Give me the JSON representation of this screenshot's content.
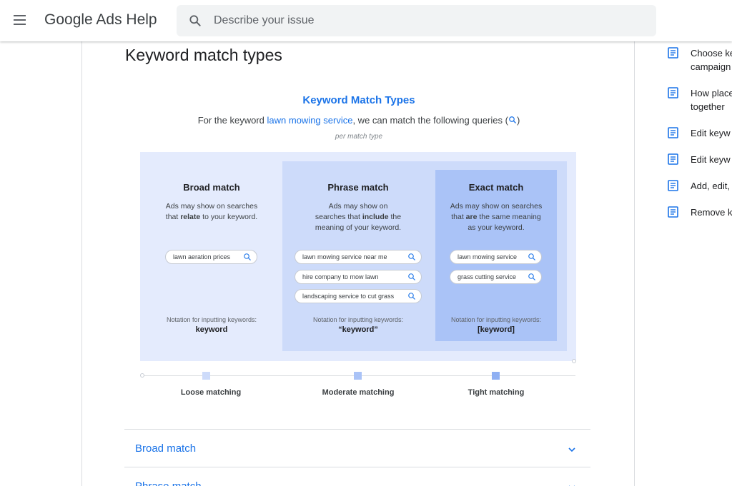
{
  "header": {
    "app_title": "Google Ads Help",
    "search_placeholder": "Describe your issue"
  },
  "article": {
    "title": "Keyword match types"
  },
  "figure": {
    "title": "Keyword Match Types",
    "subtitle_prefix": "For the keyword ",
    "subtitle_keyword": "lawn mowing service",
    "subtitle_suffix": ", we can match the following queries (",
    "subtitle_close": ")",
    "per_match_type": "per match type",
    "columns": [
      {
        "heading": "Broad match",
        "desc_l1": "Ads may show on searches",
        "desc_l2_a": "that ",
        "desc_l2_b": "relate",
        "desc_l2_c": " to your keyword.",
        "queries": [
          "lawn aeration prices"
        ],
        "notation_label": "Notation for inputting keywords:",
        "notation_value": "keyword"
      },
      {
        "heading": "Phrase match",
        "desc_l1": "Ads may show on",
        "desc_l2_a": "searches that ",
        "desc_l2_b": "include",
        "desc_l2_c": " the",
        "desc_l3": "meaning of your keyword.",
        "queries": [
          "lawn mowing service near me",
          "hire company to mow lawn",
          "landscaping service to cut grass"
        ],
        "notation_label": "Notation for inputting keywords:",
        "notation_value": "“keyword”"
      },
      {
        "heading": "Exact match",
        "desc_l1": "Ads may show on searches",
        "desc_l2_a": "that ",
        "desc_l2_b": "are",
        "desc_l2_c": " the same meaning",
        "desc_l3": "as your keyword.",
        "queries": [
          "lawn mowing service",
          "grass cutting service"
        ],
        "notation_label": "Notation for inputting keywords:",
        "notation_value": "[keyword]"
      }
    ],
    "scale": [
      "Loose matching",
      "Moderate matching",
      "Tight matching"
    ]
  },
  "accordion": [
    {
      "label": "Broad match"
    },
    {
      "label": "Phrase match"
    }
  ],
  "sidebar": {
    "items": [
      {
        "l1": "Choose ke",
        "l2": "campaign"
      },
      {
        "l1": "How place",
        "l2": "together"
      },
      {
        "l1": "Edit keyw"
      },
      {
        "l1": "Edit keyw"
      },
      {
        "l1": "Add, edit,"
      },
      {
        "l1": "Remove k"
      }
    ]
  },
  "colors": {
    "accent": "#1a73e8",
    "panel_broad": "#e4ebfd",
    "panel_phrase": "#cddbfa",
    "panel_exact": "#aac3f7"
  }
}
